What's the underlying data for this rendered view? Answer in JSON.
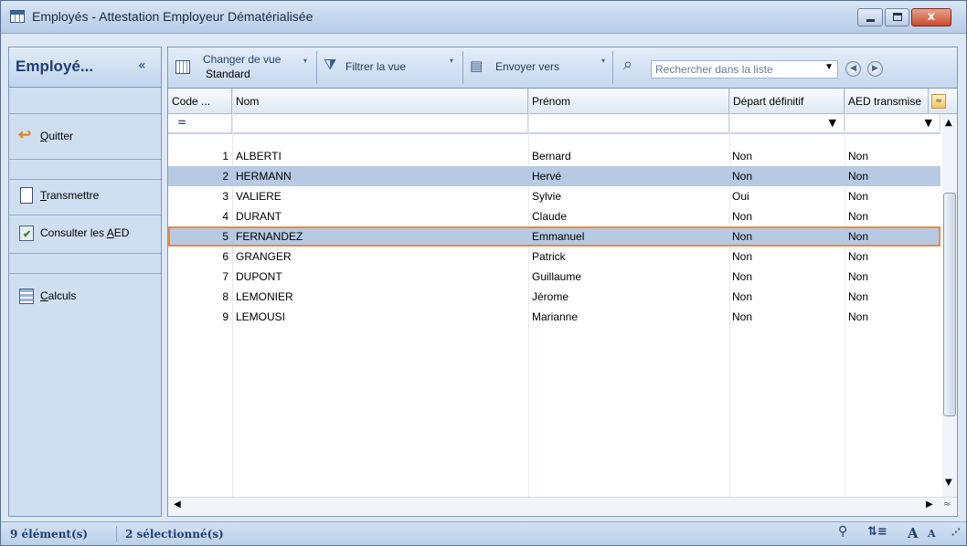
{
  "window": {
    "title": "Employés - Attestation Employeur Dématérialisée",
    "min_glyph": "",
    "close_glyph": "x"
  },
  "sidebar": {
    "title": "Employé...",
    "collapse_glyph": "«",
    "items": [
      {
        "label_u": "Q",
        "label_rest": "uitter",
        "icon": "exit-arrow-icon"
      },
      {
        "label_u": "T",
        "label_rest": "ransmettre",
        "icon": "document-icon"
      },
      {
        "label_pre": "Consulter les ",
        "label_u": "A",
        "label_rest": "ED",
        "icon": "checked-document-icon"
      },
      {
        "label_u": "C",
        "label_rest": "alculs",
        "icon": "calculator-icon"
      }
    ]
  },
  "toolbar": {
    "change_view_label": "Changer de vue",
    "change_view_value": "Standard",
    "filter_label": "Filtrer la vue",
    "send_label": "Envoyer vers",
    "search_placeholder": "Rechercher dans la liste",
    "dropdown_glyph": "▼",
    "caret_glyph": "▾",
    "prev_glyph": "◀",
    "next_glyph": "▶"
  },
  "grid": {
    "columns": [
      "Code ...",
      "Nom",
      "Prénom",
      "Départ définitif",
      "AED transmise"
    ],
    "filter_operator": "=",
    "filter_dropdown": "▼",
    "rows": [
      {
        "code": "1",
        "nom": "ALBERTI",
        "prenom": "Bernard",
        "depart": "Non",
        "aed": "Non",
        "state": "normal"
      },
      {
        "code": "2",
        "nom": "HERMANN",
        "prenom": "Hervé",
        "depart": "Non",
        "aed": "Non",
        "state": "selected"
      },
      {
        "code": "3",
        "nom": "VALIERE",
        "prenom": "Sylvie",
        "depart": "Oui",
        "aed": "Non",
        "state": "normal"
      },
      {
        "code": "4",
        "nom": "DURANT",
        "prenom": "Claude",
        "depart": "Non",
        "aed": "Non",
        "state": "normal"
      },
      {
        "code": "5",
        "nom": "FERNANDEZ",
        "prenom": "Emmanuel",
        "depart": "Non",
        "aed": "Non",
        "state": "focused"
      },
      {
        "code": "6",
        "nom": "GRANGER",
        "prenom": "Patrick",
        "depart": "Non",
        "aed": "Non",
        "state": "normal"
      },
      {
        "code": "7",
        "nom": "DUPONT",
        "prenom": "Guillaume",
        "depart": "Non",
        "aed": "Non",
        "state": "normal"
      },
      {
        "code": "8",
        "nom": "LEMONIER",
        "prenom": "Jérome",
        "depart": "Non",
        "aed": "Non",
        "state": "normal"
      },
      {
        "code": "9",
        "nom": "LEMOUSI",
        "prenom": "Marianne",
        "depart": "Non",
        "aed": "Non",
        "state": "normal"
      }
    ],
    "scroll_up": "▲",
    "scroll_down": "▼",
    "scroll_left": "◀",
    "scroll_right": "▶",
    "expand_glyph": "≈"
  },
  "status": {
    "count": "9 élément(s)",
    "selected": "2 sélectionné(s)",
    "font_up": "A",
    "font_down": "A",
    "lines_glyph": "⇅≡",
    "grip_glyph": "⋰"
  }
}
